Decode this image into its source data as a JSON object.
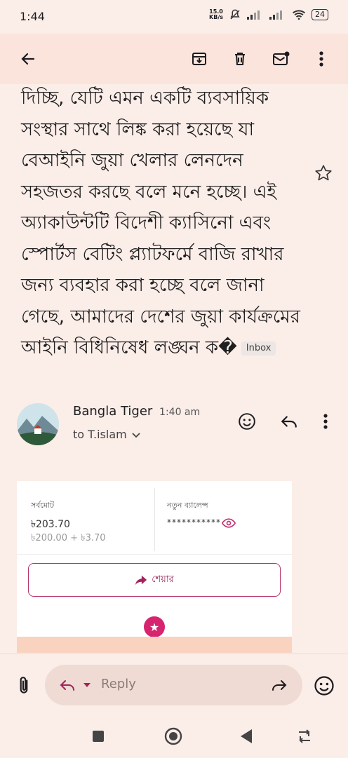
{
  "status_bar": {
    "time": "1:44",
    "net_speed_value": "15.0",
    "net_speed_unit": "KB/s",
    "battery": "24"
  },
  "toolbar": {
    "icons": [
      "back-arrow-icon",
      "archive-icon",
      "delete-icon",
      "mark-unread-icon",
      "more-vert-icon"
    ]
  },
  "email": {
    "body": "দিচ্ছি, যেটি এমন একটি ব্যবসায়িক সংস্থার সাথে লিঙ্ক করা হয়েছে যা বেআইনি জুয়া খেলার লেনদেন সহজতর করছে বলে মনে হচ্ছে। এই অ্যাকাউন্টটি বিদেশী ক্যাসিনো এবং স্পোর্টস বেটিং প্ল্যাটফর্মে বাজি রাখার জন্য ব্যবহার করা হচ্ছে বলে জানা গেছে, আমাদের দেশের জুয়া কার্যক্রমের আইনি বিধিনিষেধ লঙ্ঘন ক�",
    "label_chip": "Inbox",
    "sender_name": "Bangla Tiger",
    "sent_time": "1:40 am",
    "recipient": "to T.islam"
  },
  "card": {
    "total_label": "সর্বমোট",
    "total_value": "৳203.70",
    "total_breakdown": "৳200.00 + ৳3.70",
    "new_balance_label": "নতুন ব্যালেন্স",
    "new_balance_value": "***********",
    "share_label": "শেয়ার"
  },
  "reply_bar": {
    "placeholder": "Reply"
  },
  "colors": {
    "background": "#fbede8",
    "toolbar": "#fbe4dc",
    "accent_pink": "#d6246e"
  }
}
